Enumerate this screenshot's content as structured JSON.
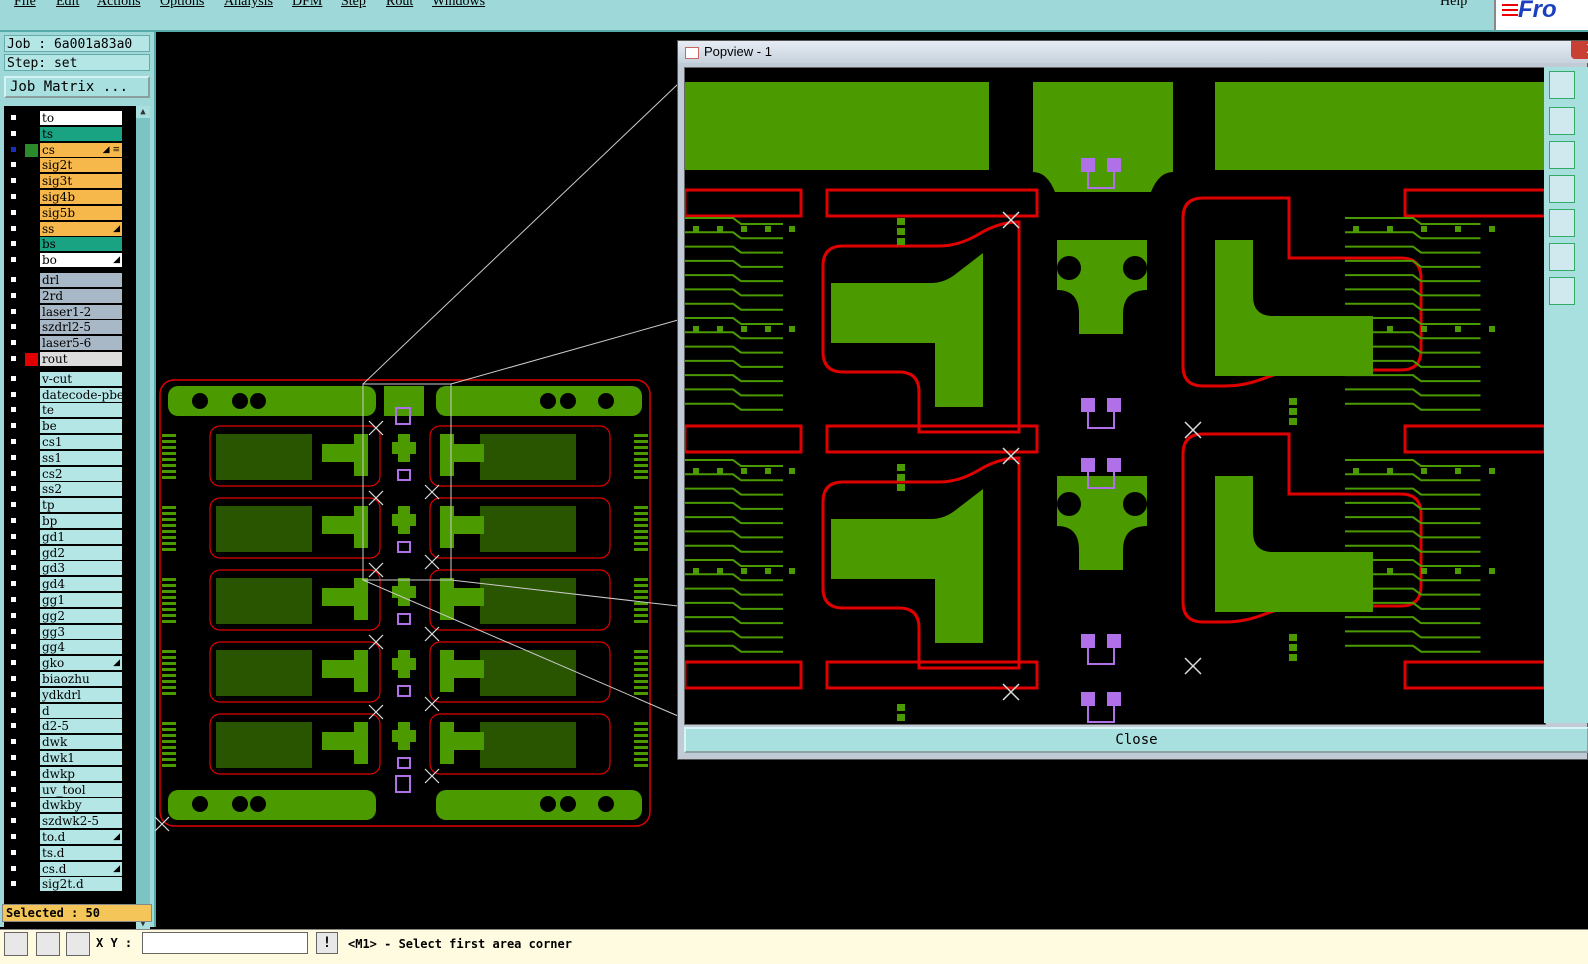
{
  "menu": {
    "items": [
      "File",
      "Edit",
      "Actions",
      "Options",
      "Analysis",
      "DFM",
      "Step",
      "Rout",
      "Windows"
    ],
    "help": "Help",
    "logo_text": "Fro"
  },
  "job": {
    "job_line": "Job : 6a001a83a0",
    "step_line": "Step: set",
    "job_matrix_button": "Job Matrix ..."
  },
  "layers": [
    {
      "name": "to",
      "color": "#ffffff"
    },
    {
      "name": "ts",
      "color": "#1aa382"
    },
    {
      "name": "cs",
      "color": "#f6b84a",
      "flag": "◢ ≡",
      "work": true
    },
    {
      "name": "sig2t",
      "color": "#f6b84a"
    },
    {
      "name": "sig3t",
      "color": "#f6b84a"
    },
    {
      "name": "sig4b",
      "color": "#f6b84a"
    },
    {
      "name": "sig5b",
      "color": "#f6b84a"
    },
    {
      "name": "ss",
      "color": "#f6b84a",
      "flag": "◢"
    },
    {
      "name": "bs",
      "color": "#1aa382"
    },
    {
      "name": "bo",
      "color": "#ffffff",
      "flag": "◢"
    },
    {
      "name": "drl",
      "color": "#a9b8c6",
      "gap": true
    },
    {
      "name": "2rd",
      "color": "#a9b8c6"
    },
    {
      "name": "laser1-2",
      "color": "#a9b8c6"
    },
    {
      "name": "szdrl2-5",
      "color": "#a9b8c6"
    },
    {
      "name": "laser5-6",
      "color": "#a9b8c6"
    },
    {
      "name": "rout",
      "color": "#dcdcdc",
      "red_mark": true
    },
    {
      "name": "v-cut",
      "color": "#b4e6e6",
      "gap": true
    },
    {
      "name": "datecode-pbe",
      "color": "#b4e6e6"
    },
    {
      "name": "te",
      "color": "#b4e6e6"
    },
    {
      "name": "be",
      "color": "#b4e6e6"
    },
    {
      "name": "cs1",
      "color": "#b4e6e6"
    },
    {
      "name": "ss1",
      "color": "#b4e6e6"
    },
    {
      "name": "cs2",
      "color": "#b4e6e6"
    },
    {
      "name": "ss2",
      "color": "#b4e6e6"
    },
    {
      "name": "tp",
      "color": "#b4e6e6"
    },
    {
      "name": "bp",
      "color": "#b4e6e6"
    },
    {
      "name": "gd1",
      "color": "#b4e6e6"
    },
    {
      "name": "gd2",
      "color": "#b4e6e6"
    },
    {
      "name": "gd3",
      "color": "#b4e6e6"
    },
    {
      "name": "gd4",
      "color": "#b4e6e6"
    },
    {
      "name": "gg1",
      "color": "#b4e6e6"
    },
    {
      "name": "gg2",
      "color": "#b4e6e6"
    },
    {
      "name": "gg3",
      "color": "#b4e6e6"
    },
    {
      "name": "gg4",
      "color": "#b4e6e6"
    },
    {
      "name": "gko",
      "color": "#b4e6e6",
      "flag": "◢"
    },
    {
      "name": "biaozhu",
      "color": "#b4e6e6"
    },
    {
      "name": "ydkdrl",
      "color": "#b4e6e6"
    },
    {
      "name": "d",
      "color": "#b4e6e6"
    },
    {
      "name": "d2-5",
      "color": "#b4e6e6"
    },
    {
      "name": "dwk",
      "color": "#b4e6e6"
    },
    {
      "name": "dwk1",
      "color": "#b4e6e6"
    },
    {
      "name": "dwkp",
      "color": "#b4e6e6"
    },
    {
      "name": "uv_tool",
      "color": "#b4e6e6"
    },
    {
      "name": "dwkby",
      "color": "#b4e6e6"
    },
    {
      "name": "szdwk2-5",
      "color": "#b4e6e6"
    },
    {
      "name": "to.d",
      "color": "#b4e6e6",
      "flag": "◢"
    },
    {
      "name": "ts.d",
      "color": "#b4e6e6"
    },
    {
      "name": "cs.d",
      "color": "#b4e6e6",
      "flag": "◢"
    },
    {
      "name": "sig2t.d",
      "color": "#b4e6e6"
    }
  ],
  "selected": "Selected : 50",
  "status": {
    "xy_label": "X Y :",
    "xy_value": "",
    "message": "<M1> - Select first area corner"
  },
  "popview": {
    "title": "Popview - 1",
    "close_x": "X",
    "close_button": "Close"
  },
  "colors": {
    "copper": "#4a9a00",
    "outline": "#e00000",
    "pad_purple": "#b070e8",
    "panel": "#9ed8d8"
  }
}
